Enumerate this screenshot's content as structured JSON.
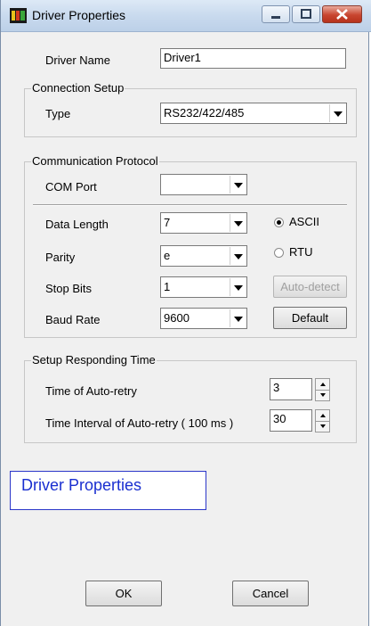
{
  "window": {
    "title": "Driver Properties"
  },
  "driver_name": {
    "label": "Driver Name",
    "value": "Driver1"
  },
  "connection_setup": {
    "group_title": "Connection Setup",
    "type_label": "Type",
    "type_value": "RS232/422/485"
  },
  "communication_protocol": {
    "group_title": "Communication Protocol",
    "com_port_label": "COM Port",
    "com_port_value": "",
    "data_length_label": "Data Length",
    "data_length_value": "7",
    "parity_label": "Parity",
    "parity_value": "e",
    "stop_bits_label": "Stop Bits",
    "stop_bits_value": "1",
    "baud_rate_label": "Baud Rate",
    "baud_rate_value": "9600",
    "mode_options": [
      {
        "label": "ASCII",
        "selected": true
      },
      {
        "label": "RTU",
        "selected": false
      }
    ],
    "auto_detect_label": "Auto-detect",
    "default_label": "Default"
  },
  "responding_time": {
    "group_title": "Setup Responding Time",
    "auto_retry_label": "Time of Auto-retry",
    "auto_retry_value": "3",
    "interval_label": "Time Interval of Auto-retry ( 100 ms )",
    "interval_value": "30"
  },
  "overlay_label": "Driver Properties",
  "buttons": {
    "ok": "OK",
    "cancel": "Cancel"
  },
  "colors": {
    "overlay_text": "#1a2fd0",
    "overlay_border": "#2b36c9",
    "close_button": "#c8452f"
  }
}
